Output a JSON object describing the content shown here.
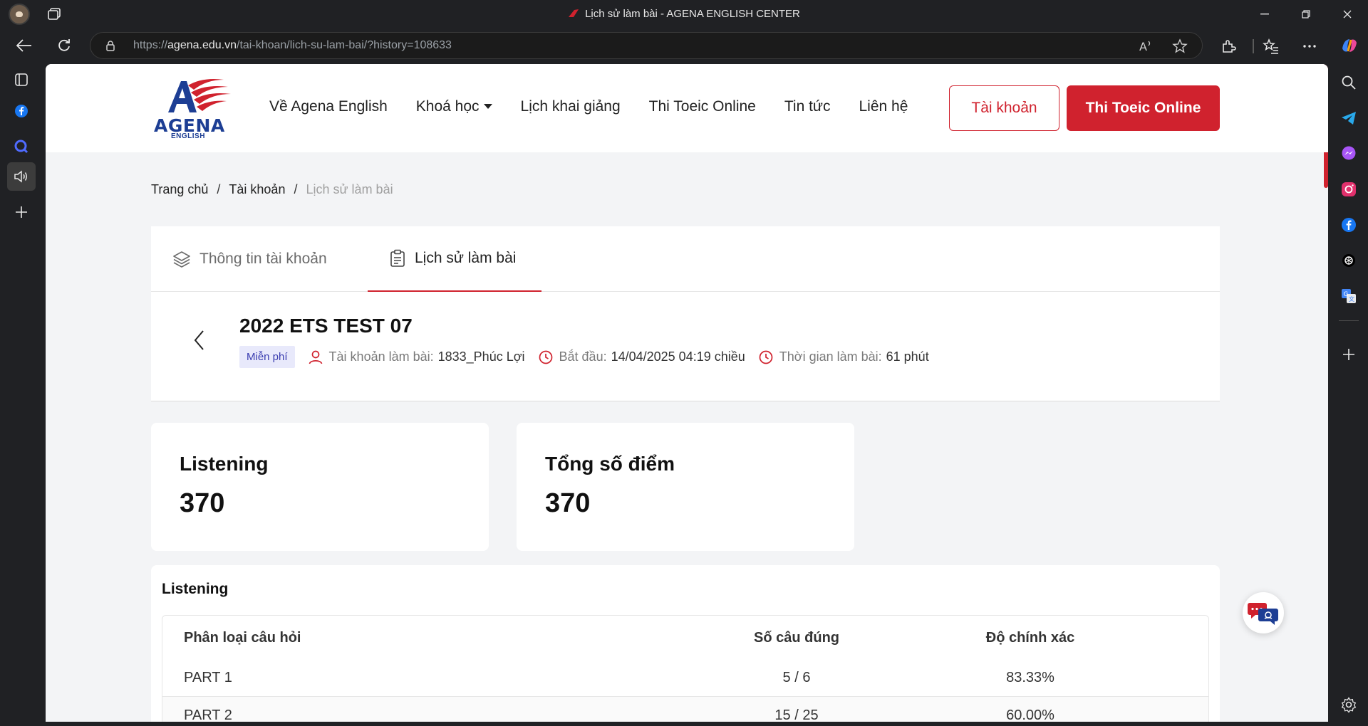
{
  "browser": {
    "tab_title": "Lịch sử làm bài - AGENA ENGLISH CENTER",
    "url_scheme_host_prefix": "https://",
    "url_host": "agena.edu.vn",
    "url_path": "/tai-khoan/lich-su-lam-bai/?history=108633"
  },
  "header": {
    "logo_text": "AGENA",
    "logo_sub": "ENGLISH",
    "menu": [
      {
        "label": "Về Agena English"
      },
      {
        "label": "Khoá học"
      },
      {
        "label": "Lịch khai giảng"
      },
      {
        "label": "Thi Toeic Online"
      },
      {
        "label": "Tin tức"
      },
      {
        "label": "Liên hệ"
      }
    ],
    "account_button": "Tài khoản",
    "cta_button": "Thi Toeic Online"
  },
  "breadcrumb": {
    "home": "Trang chủ",
    "account": "Tài khoản",
    "current": "Lịch sử làm bài"
  },
  "tabs": {
    "info": "Thông tin tài khoản",
    "history": "Lịch sử làm bài"
  },
  "test": {
    "title": "2022 ETS TEST 07",
    "badge": "Miễn phí",
    "account_label": "Tài khoản làm bài:",
    "account_value": "1833_Phúc Lợi",
    "start_label": "Bắt đầu:",
    "start_value": "14/04/2025 04:19 chiều",
    "duration_label": "Thời gian làm bài:",
    "duration_value": "61 phút"
  },
  "scores": [
    {
      "label": "Listening",
      "value": "370"
    },
    {
      "label": "Tổng số điểm",
      "value": "370"
    }
  ],
  "listening_section": {
    "title": "Listening",
    "columns": [
      "Phân loại câu hỏi",
      "Số câu đúng",
      "Độ chính xác"
    ],
    "rows": [
      {
        "part": "PART 1",
        "correct": "5 / 6",
        "accuracy": "83.33%"
      },
      {
        "part": "PART 2",
        "correct": "15 / 25",
        "accuracy": "60.00%"
      }
    ]
  },
  "colors": {
    "brand_red": "#d0222e",
    "brand_blue": "#1d3e94",
    "badge_bg": "#e8e9fb"
  }
}
